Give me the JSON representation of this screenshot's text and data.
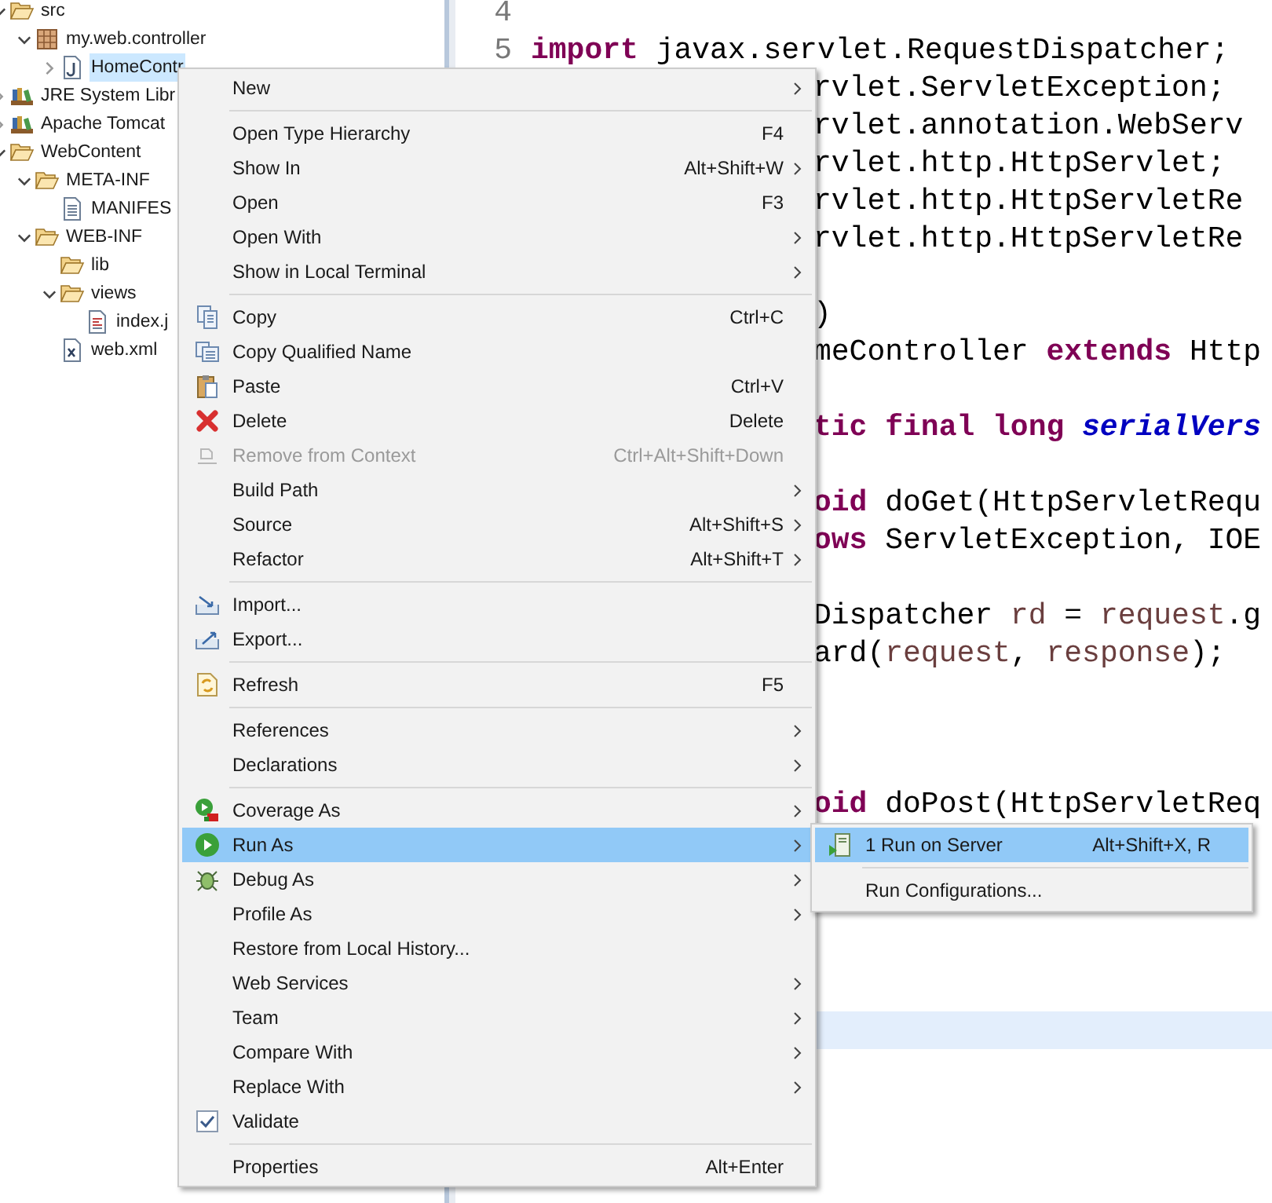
{
  "tree": [
    {
      "label": "src",
      "kind": "folder",
      "expanded": true,
      "selected": false,
      "children": [
        {
          "label": "my.web.controller",
          "kind": "package",
          "expanded": true,
          "selected": false,
          "children": [
            {
              "label": "HomeContr",
              "kind": "java",
              "expanded": false,
              "selected": true
            }
          ]
        }
      ]
    },
    {
      "label": "JRE System Libr",
      "kind": "library",
      "expanded": false,
      "selected": false
    },
    {
      "label": "Apache Tomcat",
      "kind": "library",
      "expanded": false,
      "selected": false
    },
    {
      "label": "WebContent",
      "kind": "folder",
      "expanded": true,
      "selected": false,
      "children": [
        {
          "label": "META-INF",
          "kind": "folder",
          "expanded": true,
          "selected": false,
          "children": [
            {
              "label": "MANIFES",
              "kind": "text",
              "selected": false
            }
          ]
        },
        {
          "label": "WEB-INF",
          "kind": "folder",
          "expanded": true,
          "selected": false,
          "children": [
            {
              "label": "lib",
              "kind": "folder",
              "selected": false
            },
            {
              "label": "views",
              "kind": "folder",
              "expanded": true,
              "selected": false,
              "children": [
                {
                  "label": "index.j",
                  "kind": "jsp",
                  "selected": false
                }
              ]
            },
            {
              "label": "web.xml",
              "kind": "xml",
              "selected": false
            }
          ]
        }
      ]
    }
  ],
  "editor": {
    "rows": [
      {
        "number": "4",
        "current": false
      },
      {
        "number": "5",
        "current": false,
        "tokens": [
          {
            "kind": "keyword",
            "text": "import"
          },
          {
            "kind": "plain",
            "text": " javax.servlet.RequestDispatcher;"
          }
        ]
      },
      {
        "current": false,
        "tokens": [
          {
            "kind": "plain",
            "text": "rvlet.ServletException;"
          }
        ]
      },
      {
        "current": false,
        "tokens": [
          {
            "kind": "plain",
            "text": "rvlet.annotation.WebServ"
          }
        ]
      },
      {
        "current": false,
        "tokens": [
          {
            "kind": "plain",
            "text": "rvlet.http.HttpServlet;"
          }
        ]
      },
      {
        "current": false,
        "tokens": [
          {
            "kind": "plain",
            "text": "rvlet.http.HttpServletRe"
          }
        ]
      },
      {
        "current": false,
        "tokens": [
          {
            "kind": "plain",
            "text": "rvlet.http.HttpServletRe"
          }
        ]
      },
      {
        "current": false
      },
      {
        "current": false,
        "tokens": [
          {
            "kind": "plain",
            "text": ")"
          }
        ]
      },
      {
        "current": false,
        "tokens": [
          {
            "kind": "plain",
            "text": "meController "
          },
          {
            "kind": "keyword",
            "text": "extends"
          },
          {
            "kind": "plain",
            "text": " Http"
          }
        ]
      },
      {
        "current": false
      },
      {
        "current": false,
        "tokens": [
          {
            "kind": "keyword",
            "text": "tic final long "
          },
          {
            "kind": "field",
            "text": "serialVers"
          }
        ]
      },
      {
        "current": false
      },
      {
        "current": false,
        "tokens": [
          {
            "kind": "keyword",
            "text": "oid"
          },
          {
            "kind": "plain",
            "text": " doGet(HttpServletRequ"
          }
        ]
      },
      {
        "current": false,
        "tokens": [
          {
            "kind": "keyword",
            "text": "ows"
          },
          {
            "kind": "plain",
            "text": " ServletException, IOE"
          }
        ]
      },
      {
        "current": false
      },
      {
        "current": false,
        "tokens": [
          {
            "kind": "plain",
            "text": "Dispatcher "
          },
          {
            "kind": "local",
            "text": "rd"
          },
          {
            "kind": "plain",
            "text": " = "
          },
          {
            "kind": "local",
            "text": "request"
          },
          {
            "kind": "plain",
            "text": ".g"
          }
        ]
      },
      {
        "current": false,
        "tokens": [
          {
            "kind": "plain",
            "text": "ard("
          },
          {
            "kind": "local",
            "text": "request"
          },
          {
            "kind": "plain",
            "text": ", "
          },
          {
            "kind": "local",
            "text": "response"
          },
          {
            "kind": "plain",
            "text": ");"
          }
        ]
      },
      {
        "current": false
      },
      {
        "current": false
      },
      {
        "current": false
      },
      {
        "current": false,
        "tokens": [
          {
            "kind": "keyword",
            "text": "oid"
          },
          {
            "kind": "plain",
            "text": " doPost(HttpServletReq"
          }
        ]
      },
      {
        "current": false
      },
      {
        "current": false
      },
      {
        "current": false
      },
      {
        "current": false
      },
      {
        "current": false
      },
      {
        "current": true
      }
    ]
  },
  "context_menu": {
    "entries": [
      {
        "kind": "item",
        "label": "New",
        "has_submenu": true,
        "disabled": false,
        "selected": false
      },
      {
        "kind": "separator"
      },
      {
        "kind": "item",
        "label": "Open Type Hierarchy",
        "shortcut": "F4",
        "has_submenu": false,
        "disabled": false,
        "selected": false
      },
      {
        "kind": "item",
        "label": "Show In",
        "shortcut": "Alt+Shift+W",
        "has_submenu": true,
        "disabled": false,
        "selected": false
      },
      {
        "kind": "item",
        "label": "Open",
        "shortcut": "F3",
        "has_submenu": false,
        "disabled": false,
        "selected": false
      },
      {
        "kind": "item",
        "label": "Open With",
        "has_submenu": true,
        "disabled": false,
        "selected": false
      },
      {
        "kind": "item",
        "label": "Show in Local Terminal",
        "has_submenu": true,
        "disabled": false,
        "selected": false
      },
      {
        "kind": "separator"
      },
      {
        "kind": "item",
        "label": "Copy",
        "shortcut": "Ctrl+C",
        "has_submenu": false,
        "disabled": false,
        "selected": false
      },
      {
        "kind": "item",
        "label": "Copy Qualified Name",
        "has_submenu": false,
        "disabled": false,
        "selected": false
      },
      {
        "kind": "item",
        "label": "Paste",
        "shortcut": "Ctrl+V",
        "has_submenu": false,
        "disabled": false,
        "selected": false
      },
      {
        "kind": "item",
        "label": "Delete",
        "shortcut": "Delete",
        "has_submenu": false,
        "disabled": false,
        "selected": false
      },
      {
        "kind": "item",
        "label": "Remove from Context",
        "shortcut": "Ctrl+Alt+Shift+Down",
        "has_submenu": false,
        "disabled": true,
        "selected": false
      },
      {
        "kind": "item",
        "label": "Build Path",
        "has_submenu": true,
        "disabled": false,
        "selected": false
      },
      {
        "kind": "item",
        "label": "Source",
        "shortcut": "Alt+Shift+S",
        "has_submenu": true,
        "disabled": false,
        "selected": false
      },
      {
        "kind": "item",
        "label": "Refactor",
        "shortcut": "Alt+Shift+T",
        "has_submenu": true,
        "disabled": false,
        "selected": false
      },
      {
        "kind": "separator"
      },
      {
        "kind": "item",
        "label": "Import...",
        "has_submenu": false,
        "disabled": false,
        "selected": false
      },
      {
        "kind": "item",
        "label": "Export...",
        "has_submenu": false,
        "disabled": false,
        "selected": false
      },
      {
        "kind": "separator"
      },
      {
        "kind": "item",
        "label": "Refresh",
        "shortcut": "F5",
        "has_submenu": false,
        "disabled": false,
        "selected": false
      },
      {
        "kind": "separator"
      },
      {
        "kind": "item",
        "label": "References",
        "has_submenu": true,
        "disabled": false,
        "selected": false
      },
      {
        "kind": "item",
        "label": "Declarations",
        "has_submenu": true,
        "disabled": false,
        "selected": false
      },
      {
        "kind": "separator"
      },
      {
        "kind": "item",
        "label": "Coverage As",
        "has_submenu": true,
        "disabled": false,
        "selected": false
      },
      {
        "kind": "item",
        "label": "Run As",
        "has_submenu": true,
        "disabled": false,
        "selected": true
      },
      {
        "kind": "item",
        "label": "Debug As",
        "has_submenu": true,
        "disabled": false,
        "selected": false
      },
      {
        "kind": "item",
        "label": "Profile As",
        "has_submenu": true,
        "disabled": false,
        "selected": false
      },
      {
        "kind": "item",
        "label": "Restore from Local History...",
        "has_submenu": false,
        "disabled": false,
        "selected": false
      },
      {
        "kind": "item",
        "label": "Web Services",
        "has_submenu": true,
        "disabled": false,
        "selected": false
      },
      {
        "kind": "item",
        "label": "Team",
        "has_submenu": true,
        "disabled": false,
        "selected": false
      },
      {
        "kind": "item",
        "label": "Compare With",
        "has_submenu": true,
        "disabled": false,
        "selected": false
      },
      {
        "kind": "item",
        "label": "Replace With",
        "has_submenu": true,
        "disabled": false,
        "selected": false
      },
      {
        "kind": "check",
        "label": "Validate",
        "checked": true,
        "has_submenu": false,
        "disabled": false,
        "selected": false
      },
      {
        "kind": "separator"
      },
      {
        "kind": "item",
        "label": "Properties",
        "shortcut": "Alt+Enter",
        "has_submenu": false,
        "disabled": false,
        "selected": false
      }
    ]
  },
  "submenu": {
    "entries": [
      {
        "kind": "item",
        "label": "1 Run on Server",
        "shortcut": "Alt+Shift+X, R",
        "selected": true
      },
      {
        "kind": "separator"
      },
      {
        "kind": "item",
        "label": "Run Configurations...",
        "selected": false
      }
    ]
  }
}
